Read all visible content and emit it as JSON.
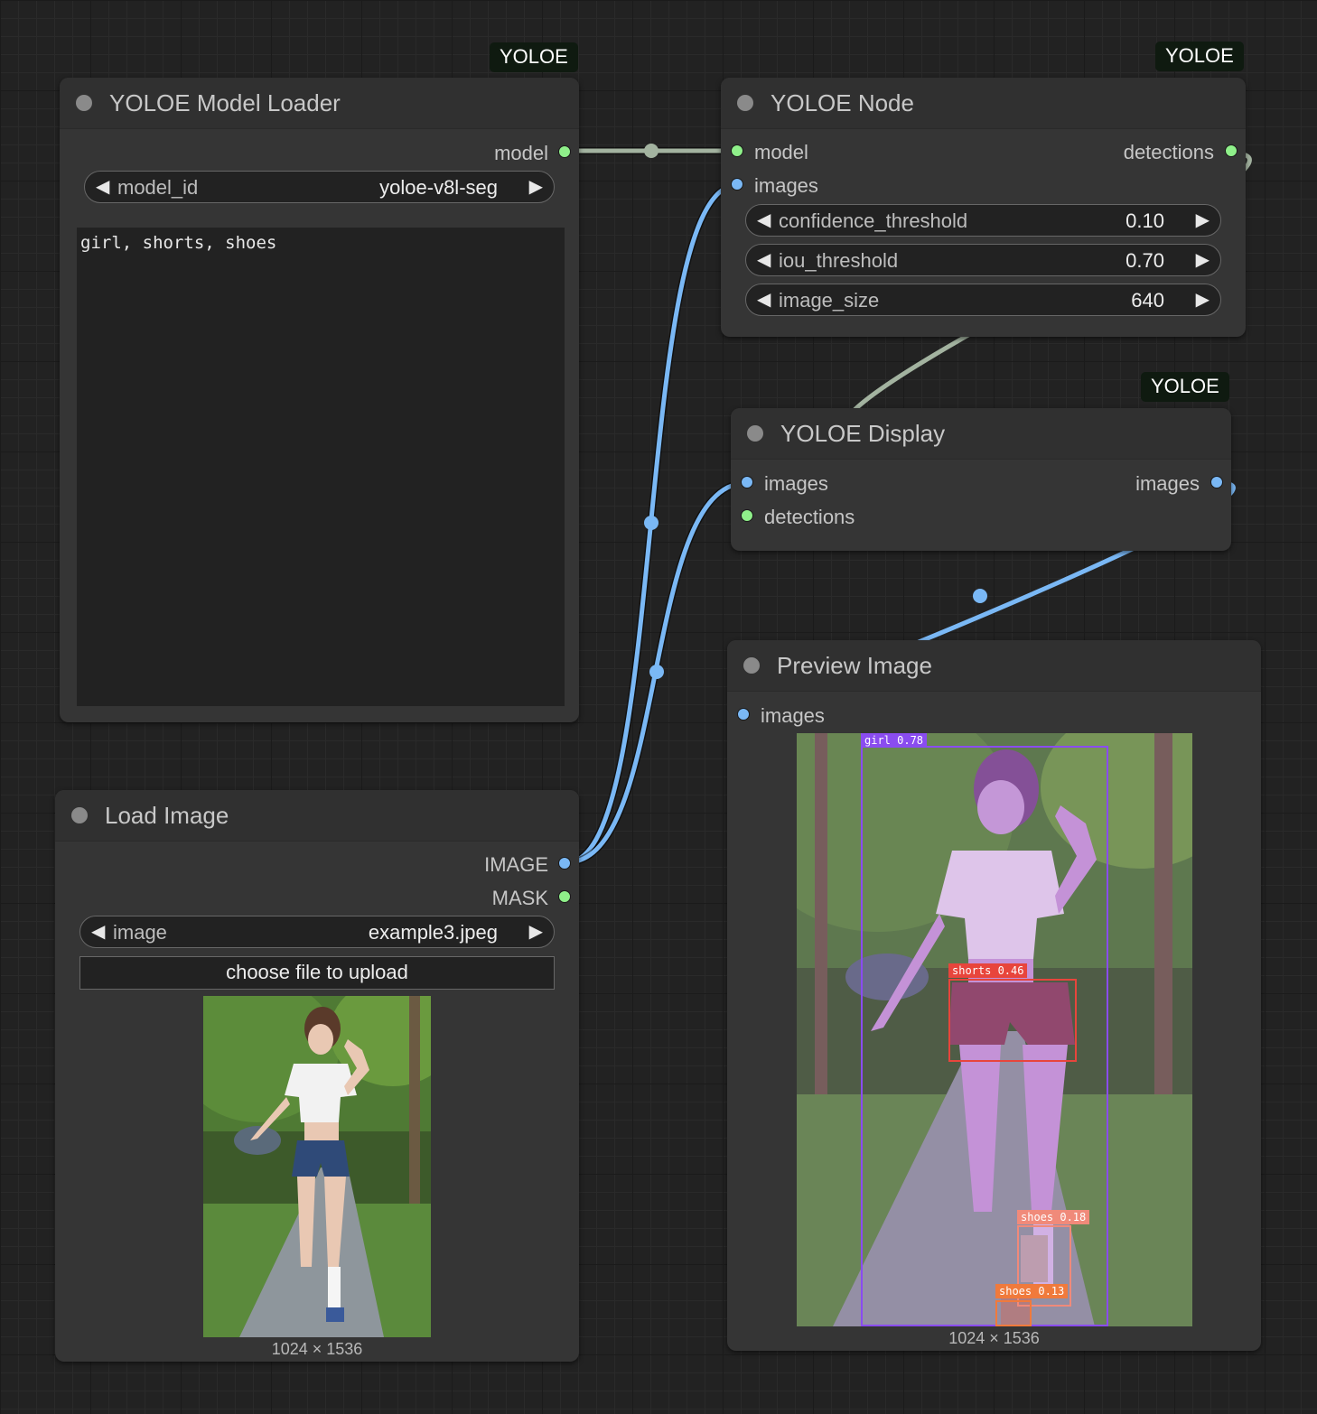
{
  "badges": {
    "loader": "YOLOE",
    "node": "YOLOE",
    "display": "YOLOE"
  },
  "nodes": {
    "model_loader": {
      "title": "YOLOE Model Loader",
      "output_model": "model",
      "widget_label": "model_id",
      "widget_value": "yoloe-v8l-seg",
      "prompt_text": "girl, shorts, shoes"
    },
    "yoloe_node": {
      "title": "YOLOE Node",
      "input_model": "model",
      "input_images": "images",
      "output_detections": "detections",
      "widgets": [
        {
          "label": "confidence_threshold",
          "value": "0.10"
        },
        {
          "label": "iou_threshold",
          "value": "0.70"
        },
        {
          "label": "image_size",
          "value": "640"
        }
      ]
    },
    "display": {
      "title": "YOLOE Display",
      "input_images": "images",
      "input_detections": "detections",
      "output_images": "images"
    },
    "load_image": {
      "title": "Load Image",
      "output_image": "IMAGE",
      "output_mask": "MASK",
      "widget_label": "image",
      "widget_value": "example3.jpeg",
      "upload_label": "choose file to upload",
      "dimensions": "1024 × 1536"
    },
    "preview": {
      "title": "Preview Image",
      "input_images": "images",
      "dimensions": "1024 × 1536",
      "detections": [
        {
          "label": "girl 0.78",
          "color": "#8a4cf0"
        },
        {
          "label": "shorts 0.46",
          "color": "#e8453c"
        },
        {
          "label": "shoes 0.18",
          "color": "#f08a7a"
        },
        {
          "label": "shoes 0.13",
          "color": "#f07a3c"
        }
      ]
    }
  },
  "icons": {
    "left_arrow": "◀",
    "right_arrow": "▶"
  },
  "colors": {
    "link_image": "#7ab8f5",
    "link_model": "#a3b3a0",
    "slot_green": "#8ff08a",
    "slot_blue": "#7ab8f5"
  }
}
